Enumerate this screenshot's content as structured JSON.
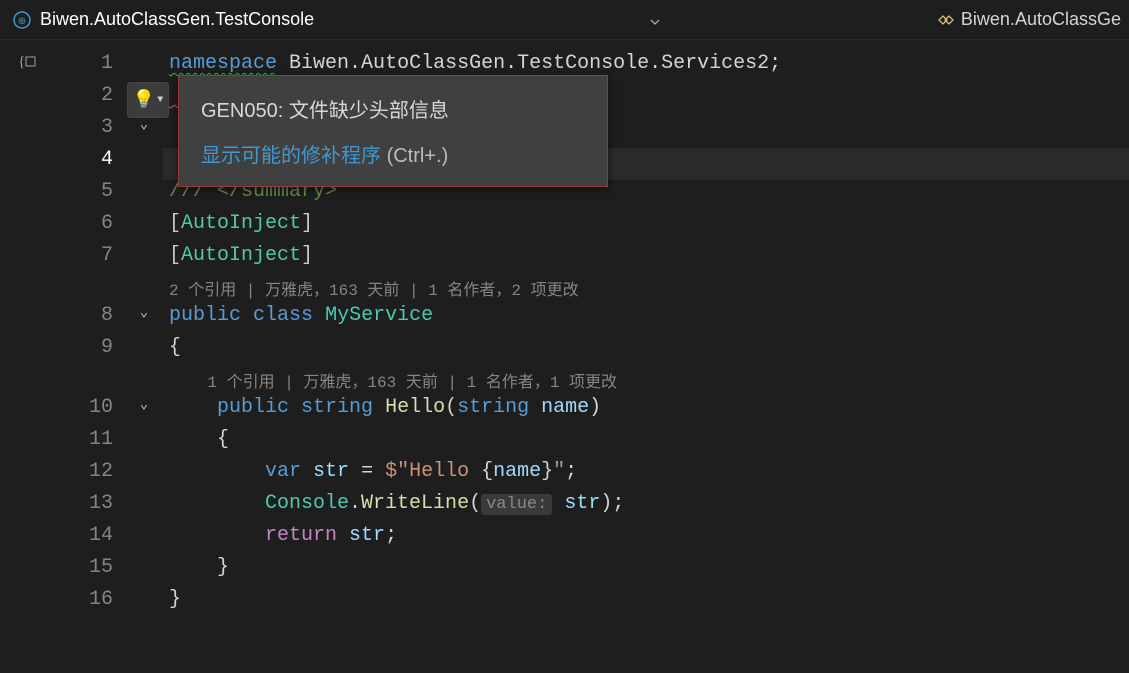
{
  "tabs": {
    "active_tab": "Biwen.AutoClassGen.TestConsole",
    "inactive_tab": "Biwen.AutoClassGe"
  },
  "gutter": {
    "outline_glyph": "{ }",
    "line_numbers": [
      "1",
      "2",
      "3",
      "4",
      "5",
      "6",
      "7",
      "8",
      "9",
      "10",
      "11",
      "12",
      "13",
      "14",
      "15",
      "16"
    ],
    "current_line": "4"
  },
  "lightbulb": {
    "glyph": "💡",
    "caret": "▼"
  },
  "tooltip": {
    "title": "GEN050: 文件缺少头部信息",
    "fix_link": "显示可能的修补程序",
    "fix_shortcut": "(Ctrl+.)"
  },
  "codelens": {
    "class": "2 个引用 | 万雅虎，163 天前 | 1 名作者，2 项更改",
    "method": "1 个引用 | 万雅虎，163 天前 | 1 名作者，1 项更改"
  },
  "code": {
    "kw_namespace": "namespace",
    "namespace_name": "Biwen.AutoClassGen.TestConsole.Services2",
    "semicolon": ";",
    "summary_close": "/// </summary>",
    "attr_open": "[",
    "attr_name": "AutoInject",
    "attr_close": "]",
    "kw_public": "public",
    "kw_class": "class",
    "class_name": "MyService",
    "brace_open": "{",
    "brace_close": "}",
    "kw_string": "string",
    "method_name": "Hello",
    "paren_open": "(",
    "paren_close": ")",
    "param_type": "string",
    "param_name": "name",
    "kw_var": "var",
    "var_name": "str",
    "op_eq": " = ",
    "str_interp_prefix": "$",
    "str_part1": "\"Hello ",
    "str_interp_open": "{",
    "str_interp_var": "name",
    "str_interp_close": "}",
    "str_part2": "\"",
    "console_class": "Console",
    "dot": ".",
    "writeline": "WriteLine",
    "hint_value": "value:",
    "kw_return": "return",
    "slash_marker": "/",
    "ellipsis": "…"
  }
}
